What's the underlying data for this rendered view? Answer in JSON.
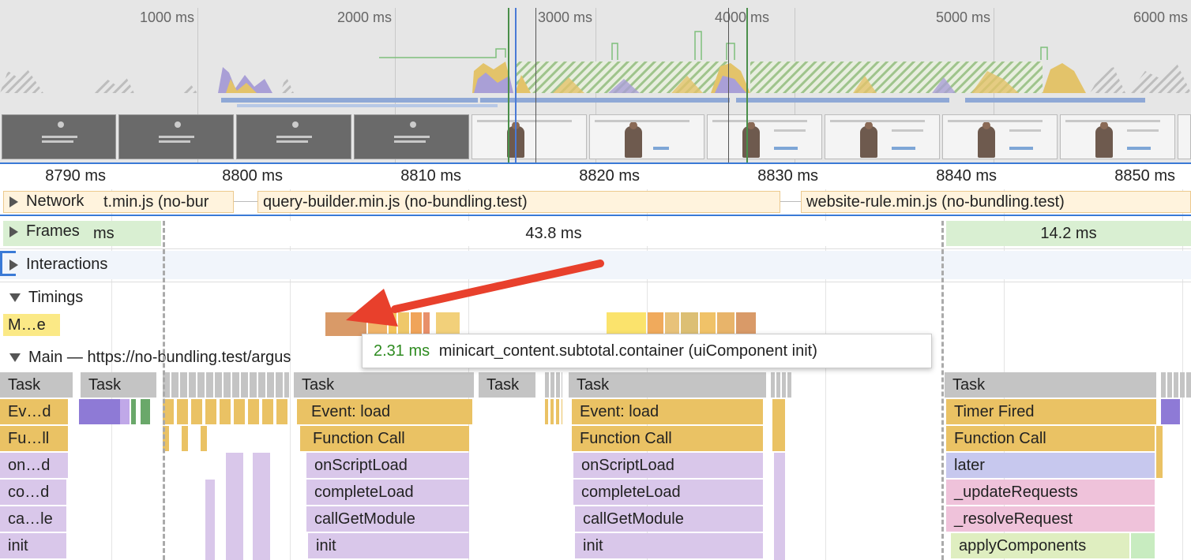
{
  "overview": {
    "time_labels": [
      "1000 ms",
      "2000 ms",
      "3000 ms",
      "4000 ms",
      "5000 ms",
      "6000 ms"
    ]
  },
  "ruler": {
    "labels": [
      "8790 ms",
      "8800 ms",
      "8810 ms",
      "8820 ms",
      "8830 ms",
      "8840 ms",
      "8850 ms"
    ]
  },
  "tracks": {
    "network": {
      "label": "Network",
      "requests": [
        "t.min.js (no-bur",
        "query-builder.min.js (no-bundling.test)",
        "website-rule.min.js (no-bundling.test)"
      ]
    },
    "frames": {
      "label": "Frames",
      "left_label": "ms",
      "mid": "43.8 ms",
      "right": "14.2 ms"
    },
    "interactions": {
      "label": "Interactions"
    },
    "timings": {
      "label": "Timings",
      "marker": "M…e"
    },
    "main": {
      "label": "Main — https://no-bundling.test/argus"
    }
  },
  "flame": {
    "task": "Task",
    "col0": [
      "Ev…d",
      "Fu…ll",
      "on…d",
      "co…d",
      "ca…le",
      "init"
    ],
    "col1": [
      "Event: load",
      "Function Call",
      "onScriptLoad",
      "completeLoad",
      "callGetModule",
      "init"
    ],
    "col2": [
      "Event: load",
      "Function Call",
      "onScriptLoad",
      "completeLoad",
      "callGetModule",
      "init"
    ],
    "col3": [
      "Timer Fired",
      "Function Call",
      "later",
      "_updateRequests",
      "_resolveRequest",
      "applyComponents"
    ]
  },
  "tooltip": {
    "duration": "2.31 ms",
    "text": "minicart_content.subtotal.container (uiComponent init)"
  },
  "colors": {
    "scripting": "#eac264",
    "loading": "#d9c7ea",
    "frame_green": "#d9efd2",
    "arrow": "#e8402c",
    "tooltip_time": "#2e8b20"
  }
}
